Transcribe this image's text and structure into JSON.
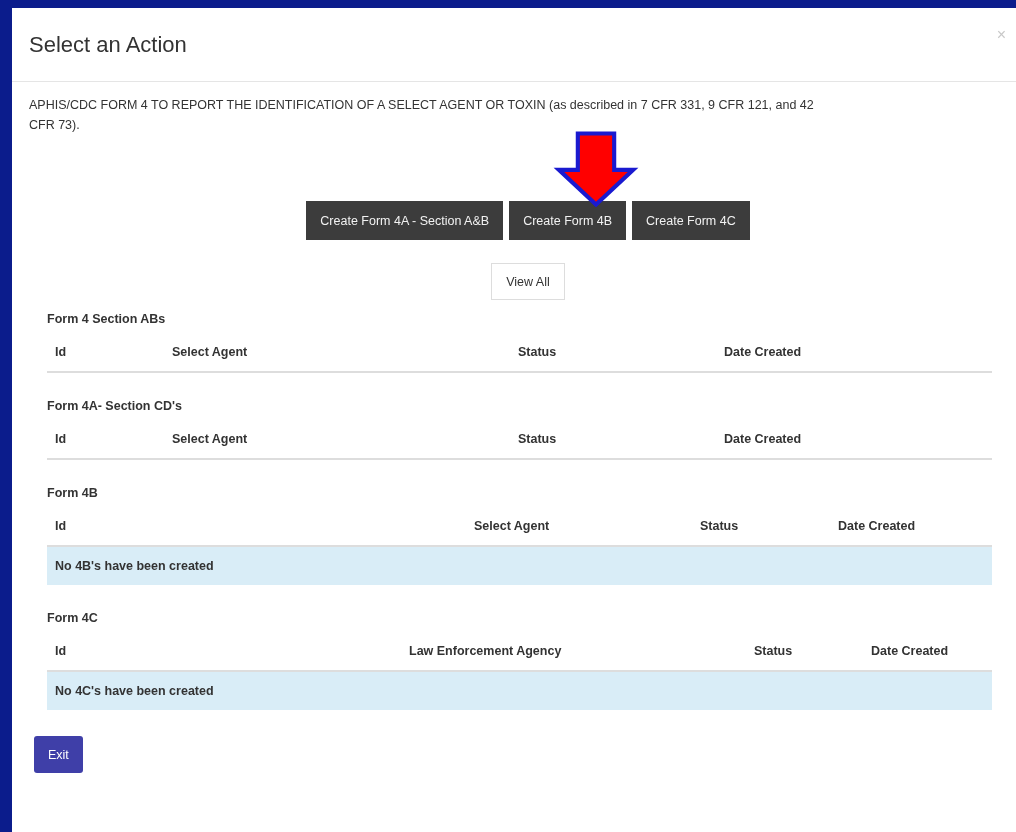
{
  "dialog": {
    "title": "Select an Action",
    "close": "×"
  },
  "description": "APHIS/CDC FORM 4 TO REPORT THE IDENTIFICATION OF A SELECT AGENT OR TOXIN (as described in 7 CFR 331, 9 CFR 121, and 42 CFR 73).",
  "create_buttons": [
    {
      "label": "Create Form 4A - Section A&B",
      "highlighted": false
    },
    {
      "label": "Create Form 4B",
      "highlighted": true
    },
    {
      "label": "Create Form 4C",
      "highlighted": false
    }
  ],
  "view_all_button": "View All",
  "tables": [
    {
      "title": "Form 4 Section ABs",
      "columns": [
        "Id",
        "Select Agent",
        "Status",
        "Date Created"
      ]
    },
    {
      "title": "Form 4A- Section CD's",
      "columns": [
        "Id",
        "Select Agent",
        "Status",
        "Date Created"
      ]
    },
    {
      "title": "Form 4B",
      "columns": [
        "Id",
        "Select Agent",
        "Status",
        "Date Created"
      ],
      "empty_message": "No 4B's have been created"
    },
    {
      "title": "Form 4C",
      "columns": [
        "Id",
        "Law Enforcement Agency",
        "Status",
        "Date Created"
      ],
      "empty_message": "No 4C's have been created"
    }
  ],
  "exit_button": "Exit"
}
